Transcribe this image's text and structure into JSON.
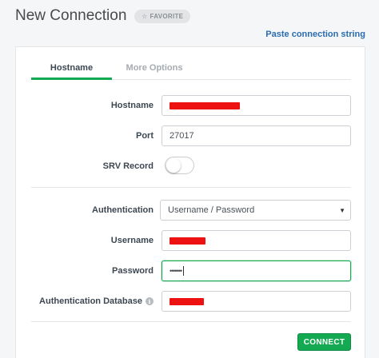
{
  "header": {
    "title": "New Connection",
    "favorite_label": "FAVORITE",
    "favorite_icon": "star-outline-icon",
    "paste_link": "Paste connection string"
  },
  "tabs": [
    {
      "label": "Hostname",
      "active": true
    },
    {
      "label": "More Options",
      "active": false
    }
  ],
  "form": {
    "hostname": {
      "label": "Hostname",
      "value": "",
      "redacted": true
    },
    "port": {
      "label": "Port",
      "value": "27017"
    },
    "srv_record": {
      "label": "SRV Record",
      "enabled": false
    },
    "authentication": {
      "label": "Authentication",
      "value": "Username / Password"
    },
    "username": {
      "label": "Username",
      "value": "",
      "redacted": true
    },
    "password": {
      "label": "Password",
      "value": "•••••••"
    },
    "auth_database": {
      "label": "Authentication Database",
      "value": "",
      "redacted": true,
      "info_icon": "info-icon"
    }
  },
  "connect_button": "CONNECT",
  "colors": {
    "accent": "#13aa52",
    "link": "#2b6cb0",
    "redaction": "#ee1111"
  }
}
